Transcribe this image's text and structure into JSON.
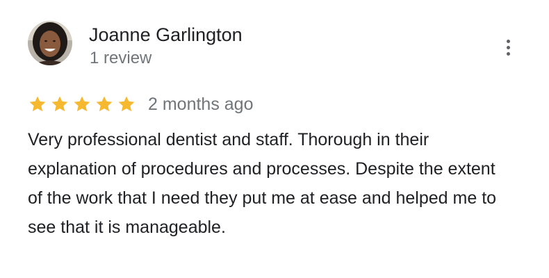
{
  "review": {
    "author_name": "Joanne Garlington",
    "author_meta": "1 review",
    "rating": 5,
    "rating_max": 5,
    "date": "2 months ago",
    "text": "Very professional dentist and staff. Thorough in their explanation of procedures and processes. Despite the extent of the work that I need they put me at ease and helped me to see that it is manageable."
  },
  "icons": {
    "star": "star-icon",
    "more": "more-vert-icon"
  },
  "colors": {
    "star": "#f5b82e",
    "primary_text": "#202124",
    "secondary_text": "#70757a"
  }
}
